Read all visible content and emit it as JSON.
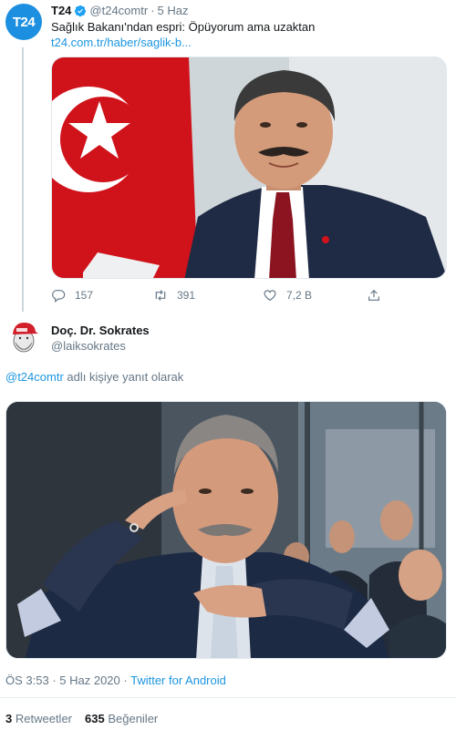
{
  "parent_tweet": {
    "avatar_text": "T24",
    "name": "T24",
    "handle": "@t24comtr",
    "dot": "·",
    "date": "5 Haz",
    "text": "Sağlık Bakanı'ndan espri: Öpüyorum ama uzaktan",
    "link": "t24.com.tr/haber/saglik-b...",
    "image_alt": "photo-minister",
    "actions": {
      "replies": "157",
      "retweets": "391",
      "likes": "7,2 B"
    }
  },
  "main_tweet": {
    "name": "Doç. Dr. Sokrates",
    "handle": "@laiksokrates",
    "reply_mention": "@t24comtr",
    "reply_suffix": " adlı kişiye yanıt olarak",
    "image_alt": "photo-president",
    "time": "ÖS 3:53",
    "dot1": " · ",
    "date": "5 Haz 2020",
    "dot2": " · ",
    "source": "Twitter for Android",
    "retweets_count": "3",
    "retweets_label": "Retweetler",
    "likes_count": "635",
    "likes_label": "Beğeniler"
  },
  "colors": {
    "link": "#1b95e0",
    "secondary_text": "#657786",
    "t24_brand": "#1d8fe0"
  }
}
